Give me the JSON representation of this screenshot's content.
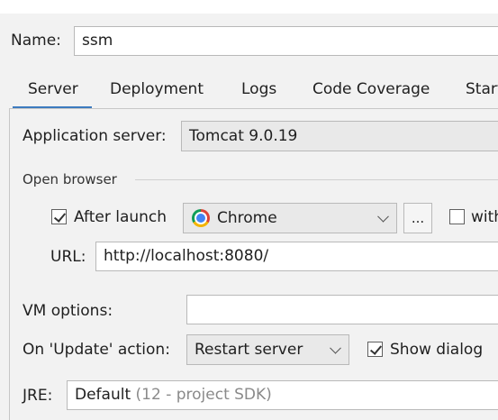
{
  "name_label": "Name:",
  "name_value": "ssm",
  "tabs": [
    "Server",
    "Deployment",
    "Logs",
    "Code Coverage",
    "Start"
  ],
  "app_server_label": "Application server:",
  "app_server_value": "Tomcat 9.0.19",
  "open_browser_label": "Open browser",
  "after_launch_label": "After launch",
  "after_launch_checked": true,
  "browser_value": "Chrome",
  "browse_button_label": "...",
  "with_label": "with",
  "url_label": "URL:",
  "url_value": "http://localhost:8080/",
  "vm_options_label": "VM options:",
  "vm_options_value": "",
  "update_action_label": "On 'Update' action:",
  "update_action_value": "Restart server",
  "show_dialog_label": "Show dialog",
  "show_dialog_checked": true,
  "jre_label": "JRE:",
  "jre_value": "Default",
  "jre_hint": "(12 - project SDK)",
  "colors": {
    "accent": "#3d7bbf",
    "background": "#f2f2f2"
  }
}
